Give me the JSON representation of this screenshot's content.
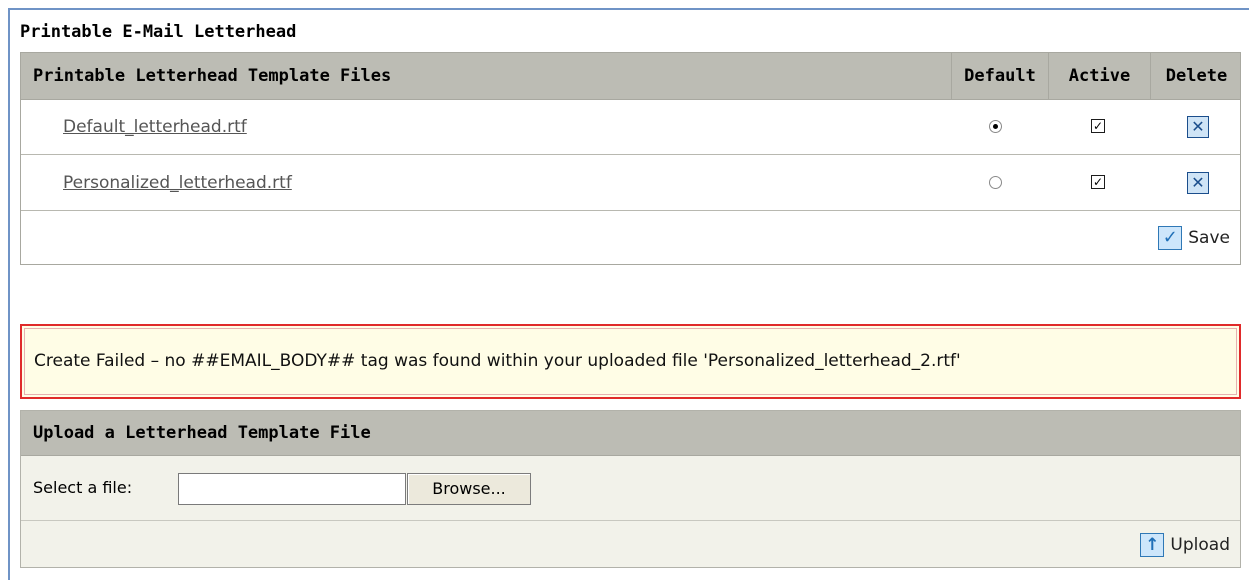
{
  "page": {
    "section_title": "Printable E-Mail Letterhead"
  },
  "letterhead_table": {
    "headers": {
      "files": "Printable Letterhead Template Files",
      "default": "Default",
      "active": "Active",
      "delete": "Delete"
    },
    "rows": [
      {
        "file": "Default_letterhead.rtf",
        "default": true,
        "active": true
      },
      {
        "file": "Personalized_letterhead.rtf",
        "default": false,
        "active": true
      }
    ],
    "save_label": "Save"
  },
  "error": {
    "message": "Create Failed – no ##EMAIL_BODY## tag was found within your uploaded file 'Personalized_letterhead_2.rtf'"
  },
  "upload": {
    "title": "Upload a Letterhead Template File",
    "select_label": "Select a file:",
    "file_value": "",
    "browse_label": "Browse...",
    "upload_label": "Upload"
  },
  "colors": {
    "header_bg": "#bcbcb4",
    "frame_border": "#6f93c6",
    "error_border": "#e02a2a",
    "error_bg": "#fffde6",
    "upload_bg": "#f2f2ea"
  }
}
